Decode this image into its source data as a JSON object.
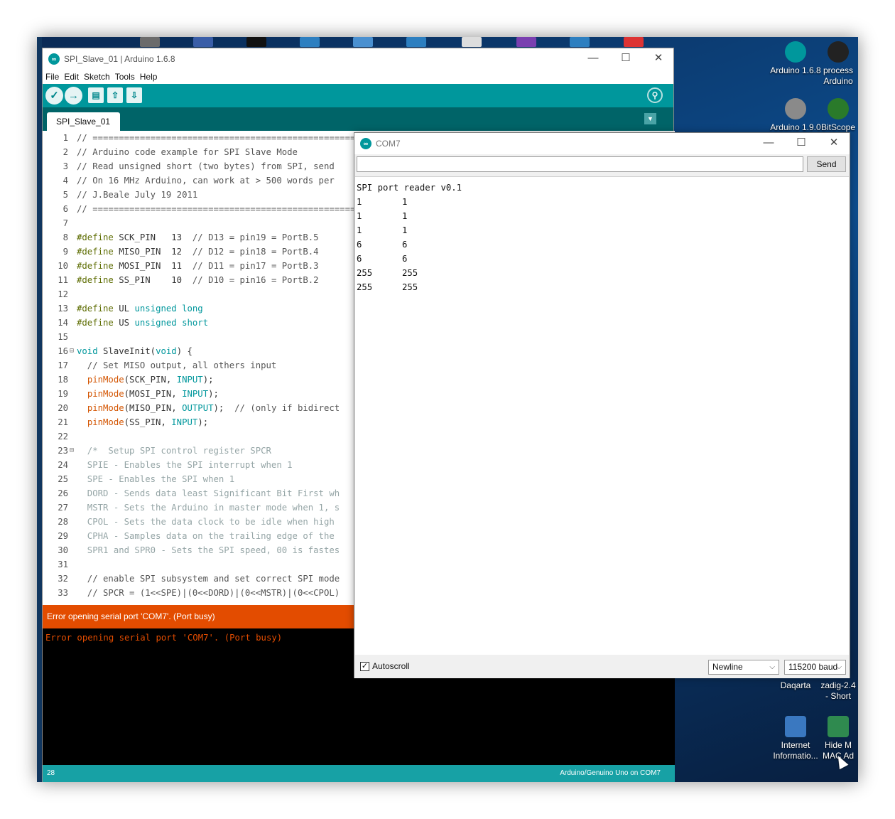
{
  "desktop": {
    "icons": [
      {
        "label": "Arduino 1.6.8",
        "color": "#00979c"
      },
      {
        "label": "process Arduino",
        "color": "#222222"
      },
      {
        "label": "Arduino 1.9.0",
        "color": "#8a8a8a"
      },
      {
        "label": "BitScope",
        "color": "#2a7a2a"
      },
      {
        "label": "Daqarta",
        "color": "#1f5fa0"
      },
      {
        "label": "zadig-2.4 - Short",
        "color": "#6a8fb8"
      },
      {
        "label": "Internet Informatio...",
        "color": "#3a78c0"
      },
      {
        "label": "Hide M MAC Ad",
        "color": "#2f8a4f"
      }
    ]
  },
  "ide": {
    "title": "SPI_Slave_01 | Arduino 1.6.8",
    "menu": [
      "File",
      "Edit",
      "Sketch",
      "Tools",
      "Help"
    ],
    "tab": "SPI_Slave_01",
    "error_bar": "Error opening serial port 'COM7'. (Port busy)",
    "console": "Error opening serial port 'COM7'. (Port busy)",
    "status_line": "28",
    "status_board": "Arduino/Genuino Uno on COM7",
    "code": [
      {
        "n": "1",
        "t": [
          [
            "c-cm",
            "// =================================================="
          ]
        ]
      },
      {
        "n": "2",
        "t": [
          [
            "c-cm",
            "// Arduino code example for SPI Slave Mode"
          ]
        ]
      },
      {
        "n": "3",
        "t": [
          [
            "c-cm",
            "// Read unsigned short (two bytes) from SPI, send"
          ]
        ]
      },
      {
        "n": "4",
        "t": [
          [
            "c-cm",
            "// On 16 MHz Arduino, can work at > 500 words per"
          ]
        ]
      },
      {
        "n": "5",
        "t": [
          [
            "c-cm",
            "// J.Beale July 19 2011"
          ]
        ]
      },
      {
        "n": "6",
        "t": [
          [
            "c-cm",
            "// =================================================="
          ]
        ]
      },
      {
        "n": "7",
        "t": []
      },
      {
        "n": "8",
        "t": [
          [
            "c-kw",
            "#define"
          ],
          [
            "code",
            " SCK_PIN   13  "
          ],
          [
            "c-cm",
            "// D13 = pin19 = PortB.5"
          ]
        ]
      },
      {
        "n": "9",
        "t": [
          [
            "c-kw",
            "#define"
          ],
          [
            "code",
            " MISO_PIN  12  "
          ],
          [
            "c-cm",
            "// D12 = pin18 = PortB.4"
          ]
        ]
      },
      {
        "n": "10",
        "t": [
          [
            "c-kw",
            "#define"
          ],
          [
            "code",
            " MOSI_PIN  11  "
          ],
          [
            "c-cm",
            "// D11 = pin17 = PortB.3"
          ]
        ]
      },
      {
        "n": "11",
        "t": [
          [
            "c-kw",
            "#define"
          ],
          [
            "code",
            " SS_PIN    10  "
          ],
          [
            "c-cm",
            "// D10 = pin16 = PortB.2"
          ]
        ]
      },
      {
        "n": "12",
        "t": []
      },
      {
        "n": "13",
        "t": [
          [
            "c-kw",
            "#define"
          ],
          [
            "code",
            " UL "
          ],
          [
            "c-ty",
            "unsigned long"
          ]
        ]
      },
      {
        "n": "14",
        "t": [
          [
            "c-kw",
            "#define"
          ],
          [
            "code",
            " US "
          ],
          [
            "c-ty",
            "unsigned short"
          ]
        ]
      },
      {
        "n": "15",
        "t": []
      },
      {
        "n": "16",
        "fold": "⊟",
        "t": [
          [
            "c-ty",
            "void"
          ],
          [
            "code",
            " SlaveInit("
          ],
          [
            "c-ty",
            "void"
          ],
          [
            "code",
            ") {"
          ]
        ]
      },
      {
        "n": "17",
        "t": [
          [
            "c-cm",
            "  // Set MISO output, all others input"
          ]
        ]
      },
      {
        "n": "18",
        "t": [
          [
            "code",
            "  "
          ],
          [
            "c-fn",
            "pinMode"
          ],
          [
            "code",
            "(SCK_PIN, "
          ],
          [
            "c-ty",
            "INPUT"
          ],
          [
            "code",
            ");"
          ]
        ]
      },
      {
        "n": "19",
        "t": [
          [
            "code",
            "  "
          ],
          [
            "c-fn",
            "pinMode"
          ],
          [
            "code",
            "(MOSI_PIN, "
          ],
          [
            "c-ty",
            "INPUT"
          ],
          [
            "code",
            ");"
          ]
        ]
      },
      {
        "n": "20",
        "t": [
          [
            "code",
            "  "
          ],
          [
            "c-fn",
            "pinMode"
          ],
          [
            "code",
            "(MISO_PIN, "
          ],
          [
            "c-ty",
            "OUTPUT"
          ],
          [
            "code",
            ");  "
          ],
          [
            "c-cm",
            "// (only if bidirect"
          ]
        ]
      },
      {
        "n": "21",
        "t": [
          [
            "code",
            "  "
          ],
          [
            "c-fn",
            "pinMode"
          ],
          [
            "code",
            "(SS_PIN, "
          ],
          [
            "c-ty",
            "INPUT"
          ],
          [
            "code",
            ");"
          ]
        ]
      },
      {
        "n": "22",
        "t": []
      },
      {
        "n": "23",
        "fold": "⊟",
        "t": [
          [
            "c-blk",
            "  /*  Setup SPI control register SPCR"
          ]
        ]
      },
      {
        "n": "24",
        "t": [
          [
            "c-blk",
            "  SPIE - Enables the SPI interrupt when 1"
          ]
        ]
      },
      {
        "n": "25",
        "t": [
          [
            "c-blk",
            "  SPE - Enables the SPI when 1"
          ]
        ]
      },
      {
        "n": "26",
        "t": [
          [
            "c-blk",
            "  DORD - Sends data least Significant Bit First wh"
          ]
        ]
      },
      {
        "n": "27",
        "t": [
          [
            "c-blk",
            "  MSTR - Sets the Arduino in master mode when 1, s"
          ]
        ]
      },
      {
        "n": "28",
        "t": [
          [
            "c-blk",
            "  CPOL - Sets the data clock to be idle when high"
          ]
        ]
      },
      {
        "n": "29",
        "t": [
          [
            "c-blk",
            "  CPHA - Samples data on the trailing edge of the"
          ]
        ]
      },
      {
        "n": "30",
        "t": [
          [
            "c-blk",
            "  SPR1 and SPR0 - Sets the SPI speed, 00 is fastes"
          ]
        ]
      },
      {
        "n": "31",
        "t": []
      },
      {
        "n": "32",
        "t": [
          [
            "c-cm",
            "  // enable SPI subsystem and set correct SPI mode"
          ]
        ]
      },
      {
        "n": "33",
        "t": [
          [
            "c-cm",
            "  // SPCR = (1<<SPE)|(0<<DORD)|(0<<MSTR)|(0<<CPOL)"
          ]
        ]
      }
    ]
  },
  "serial": {
    "title": "COM7",
    "input_value": "",
    "send_label": "Send",
    "header": "SPI port reader v0.1",
    "rows": [
      [
        "1",
        "1"
      ],
      [
        "1",
        "1"
      ],
      [
        "1",
        "1"
      ],
      [
        "6",
        "6"
      ],
      [
        "6",
        "6"
      ],
      [
        "255",
        "255"
      ],
      [
        "255",
        "255"
      ]
    ],
    "autoscroll_label": "Autoscroll",
    "autoscroll_mark": "✓",
    "line_ending": "Newline",
    "baud": "115200 baud"
  },
  "glyphs": {
    "minimize": "—",
    "maximize": "☐",
    "close": "✕",
    "dropdown": "⌵"
  }
}
